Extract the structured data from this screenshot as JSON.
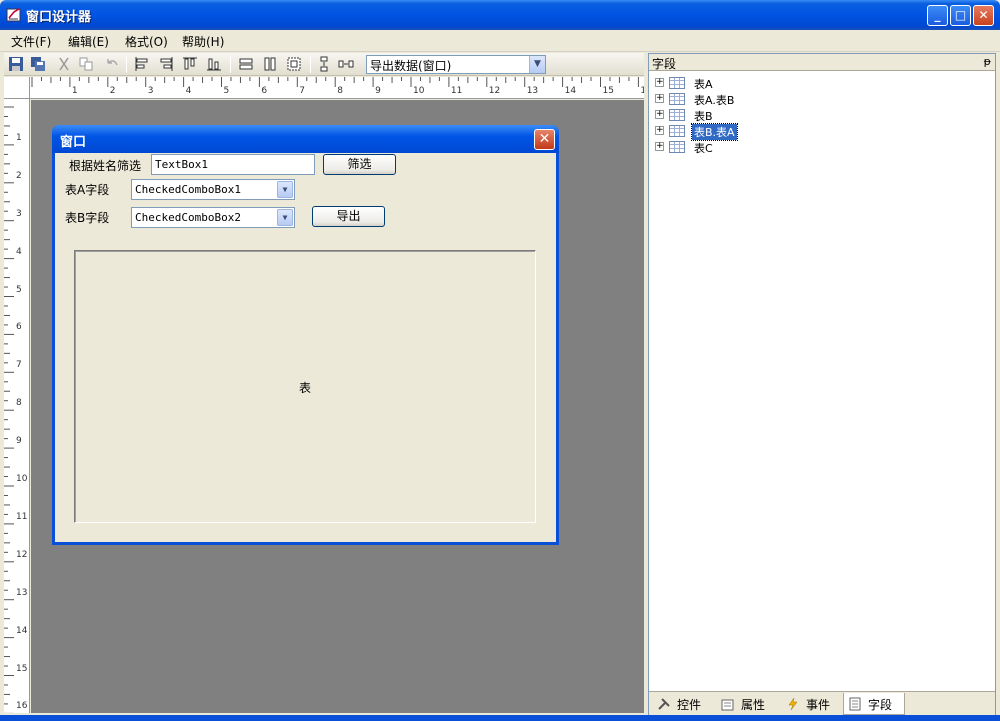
{
  "window": {
    "title": "窗口设计器",
    "controls": {
      "minimize": "_",
      "maximize": "□",
      "close": "✕"
    }
  },
  "menu": [
    {
      "label": "文件(F)"
    },
    {
      "label": "编辑(E)"
    },
    {
      "label": "格式(O)"
    },
    {
      "label": "帮助(H)"
    }
  ],
  "toolbar": {
    "combo_value": "导出数据(窗口)",
    "icons": [
      "save-icon",
      "save-all-icon",
      "cut-icon",
      "copy-icon",
      "undo-icon",
      "align-left-icon",
      "align-right-icon",
      "align-top-icon",
      "align-bottom-icon",
      "same-width-icon",
      "same-height-icon",
      "same-size-icon",
      "vertical-spacing-icon",
      "horizontal-spacing-icon"
    ]
  },
  "ruler": {
    "h_numbers": [
      "1",
      "2",
      "3",
      "4",
      "5",
      "6",
      "7",
      "8",
      "9",
      "10",
      "11",
      "12",
      "13",
      "14",
      "15",
      "16"
    ],
    "v_numbers": [
      "1",
      "2",
      "3",
      "4",
      "5",
      "6",
      "7",
      "8",
      "9",
      "10",
      "11",
      "12",
      "13",
      "14",
      "15",
      "16"
    ]
  },
  "form": {
    "title": "窗口",
    "close": "✕",
    "filter_label": "根据姓名筛选",
    "textbox_value": "TextBox1",
    "filter_button": "筛选",
    "tableA_label": "表A字段",
    "tableA_combo": "CheckedComboBox1",
    "tableB_label": "表B字段",
    "tableB_combo": "CheckedComboBox2",
    "export_button": "导出",
    "grid_caption": "表"
  },
  "fields_panel": {
    "title": "字段",
    "pin": "ᵽ",
    "tree": [
      {
        "label": "表A",
        "selected": false
      },
      {
        "label": "表A.表B",
        "selected": false
      },
      {
        "label": "表B",
        "selected": false
      },
      {
        "label": "表B.表A",
        "selected": true
      },
      {
        "label": "表C",
        "selected": false
      }
    ],
    "tabs": [
      {
        "label": "控件",
        "icon": "tools-icon",
        "active": false
      },
      {
        "label": "属性",
        "icon": "properties-icon",
        "active": false
      },
      {
        "label": "事件",
        "icon": "lightning-icon",
        "active": false
      },
      {
        "label": "字段",
        "icon": "field-list-icon",
        "active": true
      }
    ]
  }
}
